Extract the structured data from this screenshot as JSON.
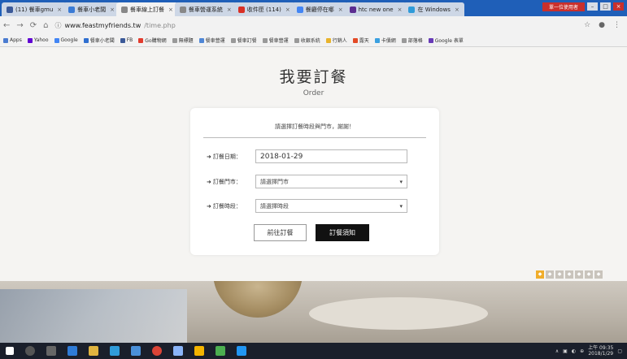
{
  "tabs": [
    {
      "label": "(11) 餐車gmu",
      "color": "#3b5998"
    },
    {
      "label": "餐車小老闆",
      "color": "#3a7bd5"
    },
    {
      "label": "餐車線上訂餐",
      "color": "#888"
    },
    {
      "label": "餐車營運系統",
      "color": "#888"
    },
    {
      "label": "收件匣 (114)",
      "color": "#d93025"
    },
    {
      "label": "餐廳停在哪",
      "color": "#4285f4"
    },
    {
      "label": "htc new one",
      "color": "#5b2d90"
    },
    {
      "label": "在 Windows",
      "color": "#2f9bd9"
    }
  ],
  "window": {
    "user_label": "單一位使用者"
  },
  "address": {
    "host": "www.feastmyfriends.tw",
    "path": "/time.php"
  },
  "bookmarks": [
    {
      "label": "Apps",
      "color": "#4a7bd0"
    },
    {
      "label": "Yahoo",
      "color": "#6001d2"
    },
    {
      "label": "Google",
      "color": "#4285f4"
    },
    {
      "label": "餐車小老闆",
      "color": "#2f6fd0"
    },
    {
      "label": "FB",
      "color": "#3b5998"
    },
    {
      "label": "Go購物網",
      "color": "#e23b2d"
    },
    {
      "label": "無標題",
      "color": "#999"
    },
    {
      "label": "餐車營運",
      "color": "#4f86d6"
    },
    {
      "label": "餐車訂餐",
      "color": "#999"
    },
    {
      "label": "餐車營運",
      "color": "#999"
    },
    {
      "label": "收銀系統",
      "color": "#999"
    },
    {
      "label": "行銷人",
      "color": "#e8b32c"
    },
    {
      "label": "露天",
      "color": "#e34a26"
    },
    {
      "label": "卡債網",
      "color": "#3aa0e0"
    },
    {
      "label": "部落格",
      "color": "#999"
    },
    {
      "label": "Google 表單",
      "color": "#673ab7"
    }
  ],
  "page": {
    "title": "我要訂餐",
    "subtitle": "Order",
    "prompt": "請選擇訂餐時段與門市，謝謝！",
    "date_label": "訂餐日期：",
    "date_value": "2018-01-29",
    "store_label": "訂餐門市：",
    "store_select": "請選擇門市",
    "time_label": "訂餐時段：",
    "time_select": "請選擇時段",
    "go_button": "前往訂餐",
    "notice_button": "訂餐須知"
  },
  "tray": {
    "time": "上午 09:35",
    "date": "2018/1/29"
  }
}
